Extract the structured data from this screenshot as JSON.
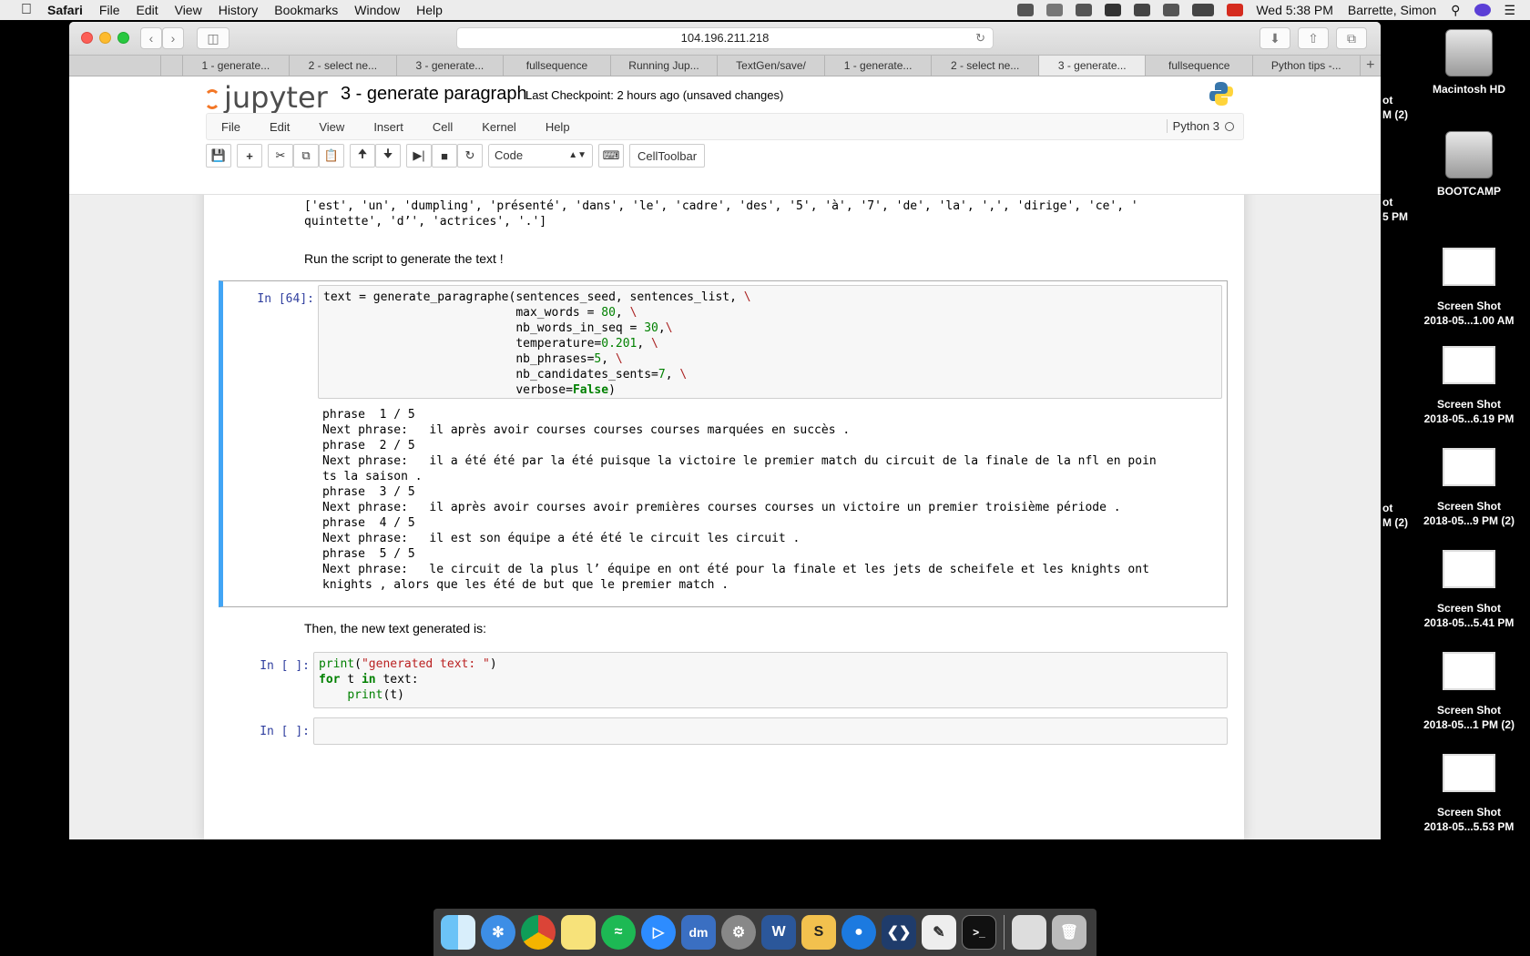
{
  "menubar": {
    "app": "Safari",
    "items": [
      "File",
      "Edit",
      "View",
      "History",
      "Bookmarks",
      "Window",
      "Help"
    ],
    "clock": "Wed 5:38 PM",
    "user": "Barrette, Simon"
  },
  "browser": {
    "url": "104.196.211.218",
    "tabs": [
      "1 - generate...",
      "2 - select ne...",
      "3 - generate...",
      "fullsequence",
      "Running Jup...",
      "TextGen/save/",
      "1 - generate...",
      "2 - select ne...",
      "3 - generate...",
      "fullsequence",
      "Python tips -..."
    ],
    "active_tab_index": 8,
    "new_tab": "+"
  },
  "jupyter": {
    "logo_text": "jupyter",
    "notebook_title": "3 - generate paragraph",
    "checkpoint": "Last Checkpoint: 2 hours ago (unsaved changes)",
    "menu": [
      "File",
      "Edit",
      "View",
      "Insert",
      "Cell",
      "Kernel",
      "Help"
    ],
    "kernel_name": "Python 3",
    "cell_type_select": "Code",
    "celltoolbar_label": "CellToolbar"
  },
  "notebook": {
    "top_output_line1": "['est', 'un', 'dumpling', 'présenté', 'dans', 'le', 'cadre', 'des', '5', 'à', '7', 'de', 'la', ',', 'dirige', 'ce', '",
    "top_output_line2": "quintette', 'd’', 'actrices', '.']",
    "markdown1": "Run the script to generate the text !",
    "cell64_prompt": "In [64]:",
    "cell64_output": [
      "phrase  1 / 5",
      "Next phrase:   il après avoir courses courses courses marquées en succès .",
      "phrase  2 / 5",
      "Next phrase:   il a été été par la été puisque la victoire le premier match du circuit de la finale de la nfl en poin",
      "ts la saison .",
      "phrase  3 / 5",
      "Next phrase:   il après avoir courses avoir premières courses courses un victoire un premier troisième période .",
      "phrase  4 / 5",
      "Next phrase:   il est son équipe a été été le circuit les circuit .",
      "phrase  5 / 5",
      "Next phrase:   le circuit de la plus l’ équipe en ont été pour la finale et les jets de scheifele et les knights ont",
      "knights , alors que les été de but que le premier match ."
    ],
    "markdown2": "Then, the new text generated is:",
    "empty_prompt": "In [ ]:"
  },
  "desktop": {
    "icons": [
      "Macintosh HD",
      "BOOTCAMP"
    ],
    "screenshots": [
      {
        "l1": "Screen Shot",
        "l2": "2018-05...1.00 AM"
      },
      {
        "l1": "Screen Shot",
        "l2": "2018-05...6.19 PM"
      },
      {
        "l1": "Screen Shot",
        "l2": "2018-05...9 PM (2)"
      },
      {
        "l1": "Screen Shot",
        "l2": "2018-05...5.41 PM"
      },
      {
        "l1": "Screen Shot",
        "l2": "2018-05...1 PM (2)"
      },
      {
        "l1": "Screen Shot",
        "l2": "2018-05...5.53 PM"
      }
    ],
    "cut_labels": [
      "ot",
      "M (2)",
      "ot",
      "5 PM",
      "ot",
      "M (2)"
    ]
  },
  "dock": {
    "apps": [
      "finder-icon",
      "safari-icon",
      "chrome-icon",
      "notes-icon",
      "spotify-icon",
      "zoom-icon",
      "dm-icon",
      "system-preferences-icon",
      "word-icon",
      "slack-icon",
      "maps-icon",
      "vscode-icon",
      "textedit-icon",
      "terminal-icon",
      "preview-icon",
      "trash-icon"
    ],
    "dm_label": "dm",
    "word_label": "W",
    "slack_label": "S"
  },
  "colors": {
    "accent_blue": "#42a5f5",
    "jupyter_orange": "#f37726",
    "prompt_blue": "#303f9f"
  }
}
